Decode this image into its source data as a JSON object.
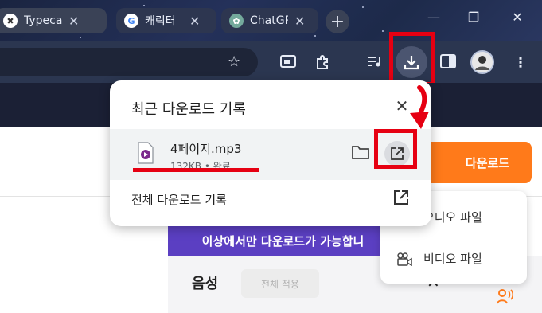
{
  "tabs": [
    {
      "title": "Typecast",
      "close": "✕",
      "favicon": "typecast-icon"
    },
    {
      "title": "캐릭터",
      "close": "✕",
      "favicon": "google-icon"
    },
    {
      "title": "ChatGPT",
      "close": "✕",
      "favicon": "chatgpt-icon"
    }
  ],
  "new_tab_symbol": "+",
  "window_controls": {
    "minimize": "—",
    "maximize": "❐",
    "close": "✕"
  },
  "download_bubble": {
    "title": "최근 다운로드 기록",
    "close_symbol": "✕",
    "item": {
      "file_name": "4페이지.mp3",
      "meta": "132KB • 완료"
    },
    "all_downloads_label": "전체 다운로드 기록"
  },
  "page": {
    "download_button": "다운로드",
    "banner_text": "이상에서만 다운로드가 가능합니",
    "voice_label": "음성",
    "apply_all_button": "전체 적용",
    "close_symbol": "✕",
    "faint_label": "일"
  },
  "dropdown_menu": {
    "items": [
      {
        "label": "오디오 파일",
        "icon": "audio-file-icon"
      },
      {
        "label": "비디오 파일",
        "icon": "video-file-icon"
      }
    ]
  },
  "colors": {
    "accent_orange": "#ff7a1a",
    "banner_purple": "#5b3fc2",
    "annotation_red": "#e60012",
    "toolbar": "#2b3650"
  }
}
